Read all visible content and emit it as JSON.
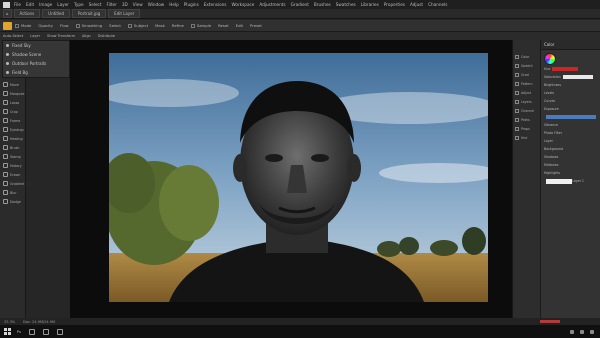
{
  "menubar": {
    "items": [
      "File",
      "Edit",
      "Image",
      "Layer",
      "Type",
      "Select",
      "Filter",
      "3D",
      "View",
      "Window",
      "Help",
      "Plugins",
      "Extensions",
      "Workspace",
      "Adjustments",
      "Gradient",
      "Brushes",
      "Swatches",
      "Libraries",
      "Properties",
      "Adjust",
      "Channels",
      "Paths",
      "Character"
    ]
  },
  "tabs": {
    "items": [
      "Actions",
      "Untitled",
      "Portrait.jpg",
      "Edit Layer"
    ]
  },
  "options": {
    "items": [
      "Mode",
      "Opacity",
      "Flow",
      "Smoothing",
      "Select",
      "Subject",
      "Mask",
      "Refine",
      "Sample",
      "Reset",
      "Edit",
      "Preset"
    ]
  },
  "subbar": {
    "items": [
      "Auto-Select",
      "Layer",
      "Show Transform",
      "Align",
      "Distribute"
    ]
  },
  "flyout": {
    "items": [
      "Fixed Sky",
      "Shadow Scene",
      "Outdoor Portraits",
      "Field Bg"
    ]
  },
  "toolbar": {
    "items": [
      "Move",
      "Marquee",
      "Lasso",
      "Crop",
      "Frame",
      "Eyedrop",
      "Healing",
      "Brush",
      "Stamp",
      "History",
      "Eraser",
      "Gradient",
      "Blur",
      "Dodge",
      "Pen",
      "Type",
      "Path",
      "Shape"
    ]
  },
  "rightpanel": {
    "items": [
      "Color",
      "Swatch",
      "Grad",
      "Pattern",
      "Adjust",
      "Layers",
      "Channel",
      "Paths",
      "Props",
      "Hist"
    ]
  },
  "props": {
    "title": "Color",
    "rows": [
      "Hue",
      "Saturation",
      "Brightness",
      "Levels",
      "Curves",
      "Exposure",
      "Vibrance",
      "Photo Filter",
      "Layer",
      "Background",
      "Shadows",
      "Midtones",
      "Highlights",
      "Layer 1"
    ]
  },
  "statusbar": {
    "zoom": "33.3%",
    "info": "Doc: 24.9M/24.9M"
  },
  "taskbar": {
    "items": [
      "Ps",
      "Explorer",
      "Browser",
      "Files"
    ]
  },
  "colors": {
    "accent": "#e2a42c",
    "alert": "#c62828",
    "selection": "#4a7bbd"
  }
}
